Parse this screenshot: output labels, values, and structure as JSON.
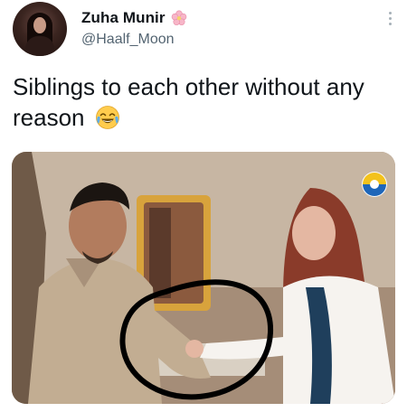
{
  "tweet": {
    "author": {
      "display_name": "Zuha Munir",
      "handle": "@Haalf_Moon",
      "name_icon": "cherry-blossom-icon",
      "avatar": "avatar"
    },
    "text": "Siblings to each other without any reason",
    "text_emoji": "face-with-tears-of-joy-icon",
    "media": {
      "description_icon": "image",
      "watermark_icon": "geo-tv-logo-icon"
    }
  },
  "colors": {
    "text_primary": "#0f1419",
    "text_secondary": "#536471",
    "more_dots": "#a6b0b8",
    "annotation_circle": "#000000"
  }
}
